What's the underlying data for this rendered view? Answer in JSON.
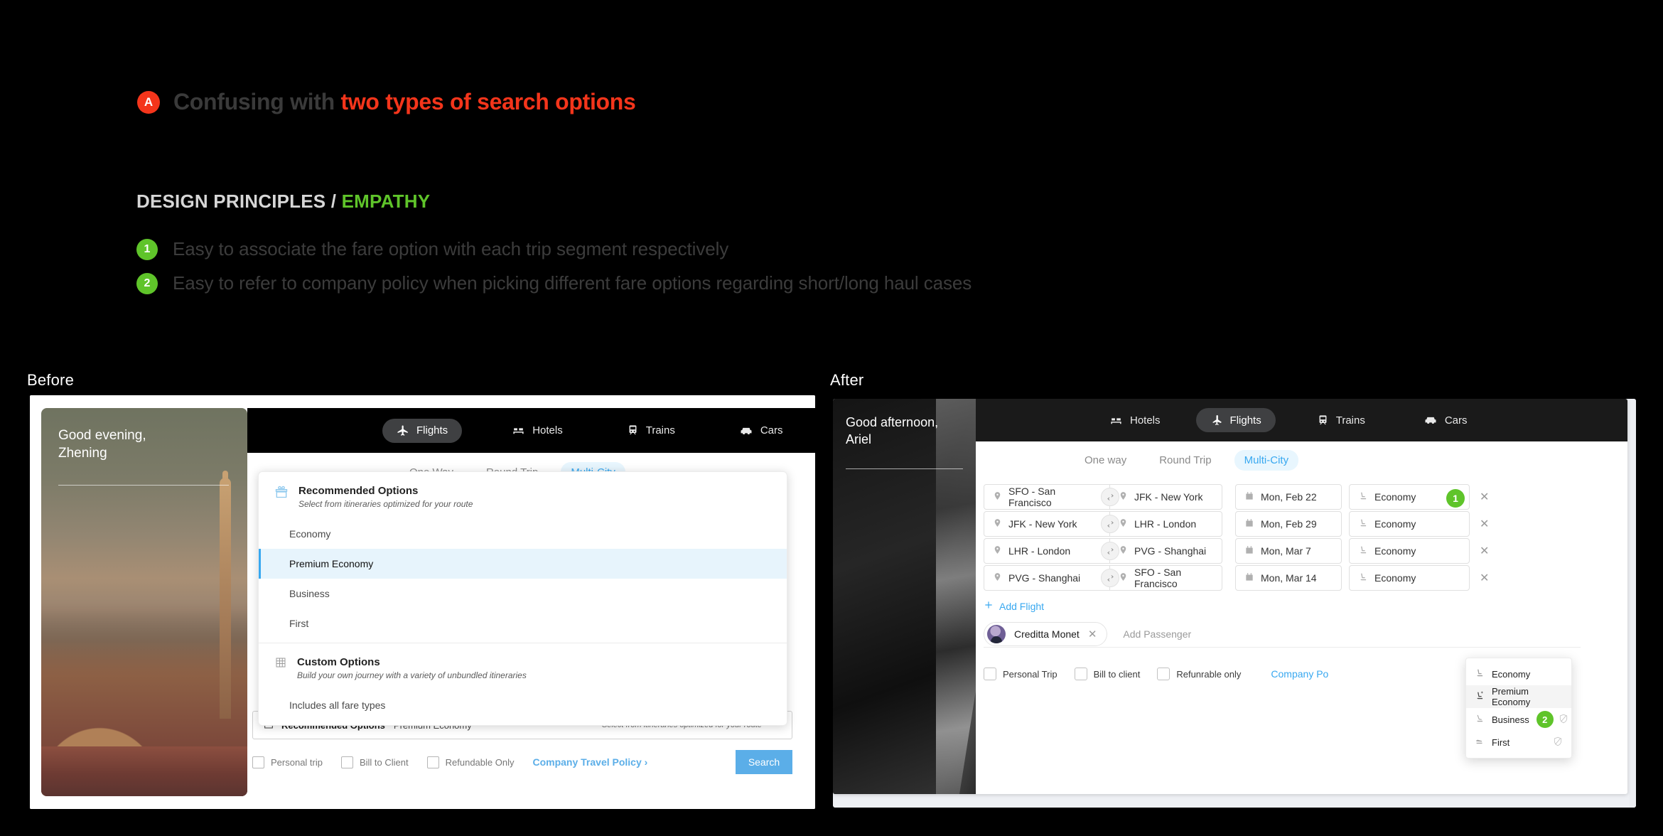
{
  "annotation": {
    "badge_a": "A",
    "problem_prefix": "Confusing with ",
    "problem_highlight": "two types of search options",
    "principles_label": "DESIGN PRINCIPLES / ",
    "principles_value": "EMPATHY",
    "principles": [
      {
        "num": "1",
        "text": "Easy to associate the fare option with each trip segment respectively"
      },
      {
        "num": "2",
        "text": "Easy to refer to company policy when picking different fare options regarding  short/long haul cases"
      }
    ],
    "colors": {
      "red": "#F4351B",
      "green": "#5FC42A",
      "blue": "#38A8F0"
    }
  },
  "captions": {
    "before": "Before",
    "after": "After"
  },
  "before": {
    "greeting_line1": "Good evening,",
    "greeting_line2": "Zhening",
    "nav": [
      {
        "label": "Flights",
        "icon": "plane-icon",
        "active": true
      },
      {
        "label": "Hotels",
        "icon": "bed-icon",
        "active": false
      },
      {
        "label": "Trains",
        "icon": "train-icon",
        "active": false
      },
      {
        "label": "Cars",
        "icon": "car-icon",
        "active": false
      }
    ],
    "trip_tabs": [
      {
        "label": "One Way",
        "active": false
      },
      {
        "label": "Round Trip",
        "active": false
      },
      {
        "label": "Multi-City",
        "active": true
      }
    ],
    "fare_panel": {
      "recommended_title": "Recommended Options",
      "recommended_sub": "Select from itineraries optimized for your route",
      "recommended_icon": "gift-icon",
      "options": [
        {
          "label": "Economy",
          "selected": false
        },
        {
          "label": "Premium Economy",
          "selected": true
        },
        {
          "label": "Business",
          "selected": false
        },
        {
          "label": "First",
          "selected": false
        }
      ],
      "custom_title": "Custom Options",
      "custom_sub": "Build your own journey with a variety of unbundled itineraries",
      "custom_icon": "grid-icon",
      "custom_options": [
        {
          "label": "Includes all fare types"
        }
      ]
    },
    "summary": {
      "icon": "gift-icon",
      "label": "Recommended Options",
      "value": "Premium Economy",
      "hint": "Select from itineraries optimized for your route",
      "chevron": "chevron-up-icon"
    },
    "checkboxes": [
      {
        "label": "Personal trip"
      },
      {
        "label": "Bill to Client"
      },
      {
        "label": "Refundable Only"
      }
    ],
    "policy_link": "Company Travel Policy ›",
    "search_button": "Search"
  },
  "after": {
    "greeting_line1": "Good afternoon,",
    "greeting_line2": "Ariel",
    "nav": [
      {
        "label": "Hotels",
        "icon": "bed-icon",
        "active": false
      },
      {
        "label": "Flights",
        "icon": "plane-icon",
        "active": true
      },
      {
        "label": "Trains",
        "icon": "train-icon",
        "active": false
      },
      {
        "label": "Cars",
        "icon": "car-icon",
        "active": false
      }
    ],
    "trip_tabs": [
      {
        "label": "One way",
        "active": false
      },
      {
        "label": "Round Trip",
        "active": false
      },
      {
        "label": "Multi-City",
        "active": true
      }
    ],
    "segments": [
      {
        "from": "SFO - San Francisco",
        "to": "JFK - New York",
        "date": "Mon, Feb 22",
        "fare": "Economy"
      },
      {
        "from": "JFK - New York",
        "to": "LHR - London",
        "date": "Mon, Feb 29",
        "fare": "Economy"
      },
      {
        "from": "LHR - London",
        "to": "PVG - Shanghai",
        "date": "Mon, Mar 7",
        "fare": "Economy"
      },
      {
        "from": "PVG - Shanghai",
        "to": "SFO - San Francisco",
        "date": "Mon, Mar 14",
        "fare": "Economy"
      }
    ],
    "add_flight": "Add Flight",
    "passenger": {
      "name": "Creditta Monet",
      "placeholder": "Add Passenger"
    },
    "checkboxes": [
      {
        "label": "Personal Trip"
      },
      {
        "label": "Bill to client"
      },
      {
        "label": "Refunrable only"
      }
    ],
    "policy_link": "Company Po",
    "fare_dropdown": [
      {
        "label": "Economy",
        "icon": "seat-icon",
        "highlight": false,
        "restricted": false,
        "badge": ""
      },
      {
        "label": "Premium Economy",
        "icon": "seat-plus-icon",
        "highlight": true,
        "restricted": false,
        "badge": ""
      },
      {
        "label": "Business",
        "icon": "seat-recline-icon",
        "highlight": false,
        "restricted": true,
        "badge": "2"
      },
      {
        "label": "First",
        "icon": "seat-flat-icon",
        "highlight": false,
        "restricted": true,
        "badge": ""
      }
    ],
    "callout_badge_1": "1"
  }
}
